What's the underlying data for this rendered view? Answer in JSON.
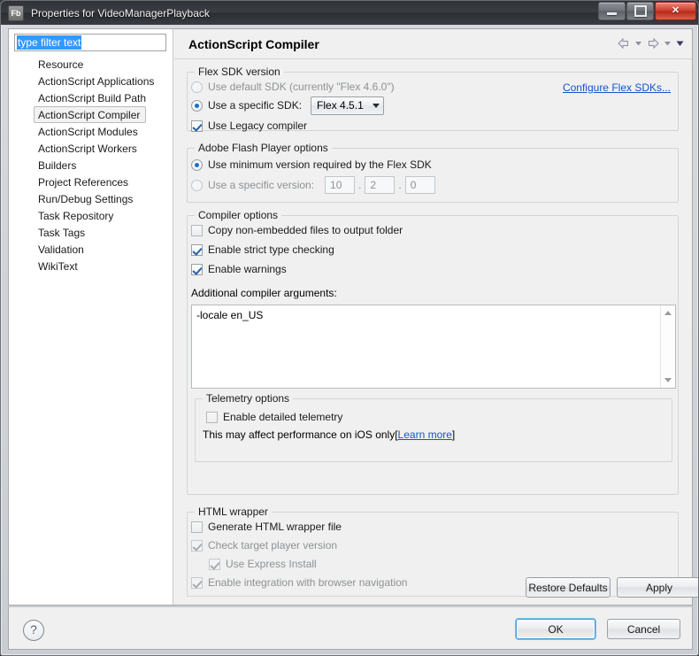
{
  "window": {
    "icon_label": "Fb",
    "title": "Properties for VideoManagerPlayback",
    "minimize_title": "Minimize",
    "maximize_title": "Maximize",
    "close_title": "Close"
  },
  "sidebar": {
    "filter": {
      "value": "type filter text",
      "placeholder": "type filter text"
    },
    "items": [
      {
        "label": "Resource",
        "selected": false
      },
      {
        "label": "ActionScript Applications",
        "selected": false
      },
      {
        "label": "ActionScript Build Path",
        "selected": false
      },
      {
        "label": "ActionScript Compiler",
        "selected": true
      },
      {
        "label": "ActionScript Modules",
        "selected": false
      },
      {
        "label": "ActionScript Workers",
        "selected": false
      },
      {
        "label": "Builders",
        "selected": false
      },
      {
        "label": "Project References",
        "selected": false
      },
      {
        "label": "Run/Debug Settings",
        "selected": false
      },
      {
        "label": "Task Repository",
        "selected": false
      },
      {
        "label": "Task Tags",
        "selected": false
      },
      {
        "label": "Validation",
        "selected": false
      },
      {
        "label": "WikiText",
        "selected": false
      }
    ]
  },
  "page": {
    "title": "ActionScript Compiler"
  },
  "sdk_group": {
    "legend": "Flex SDK version",
    "default_sdk_label": "Use default SDK (currently \"Flex 4.6.0\")",
    "specific_sdk_label": "Use a specific SDK:",
    "sdk_combo_value": "Flex 4.5.1",
    "legacy_compiler_label": "Use Legacy compiler",
    "configure_link": "Configure Flex SDKs..."
  },
  "flash_player_group": {
    "legend": "Adobe Flash Player options",
    "minimum_version_label": "Use minimum version required by the Flex SDK",
    "specific_version_label": "Use a specific version:",
    "version_major": "10",
    "version_minor": "2",
    "version_revision": "0",
    "separator": "."
  },
  "compiler_group": {
    "legend": "Compiler options",
    "copy_non_embedded_label": "Copy non-embedded files to output folder",
    "strict_type_label": "Enable strict type checking",
    "warnings_label": "Enable warnings",
    "additional_args_label": "Additional compiler arguments:",
    "additional_args_value": "-locale en_US"
  },
  "telemetry_group": {
    "legend": "Telemetry options",
    "enable_label": "Enable detailed telemetry",
    "note_prefix": "This may affect performance on iOS only[",
    "note_link": "Learn more",
    "note_suffix": "]"
  },
  "html_wrapper_group": {
    "legend": "HTML wrapper",
    "generate_label": "Generate HTML wrapper file",
    "check_target_label": "Check target player version",
    "express_install_label": "Use Express Install",
    "browser_navigation_label": "Enable integration with browser navigation"
  },
  "page_buttons": {
    "restore_defaults": "Restore Defaults",
    "apply": "Apply"
  },
  "dialog_buttons": {
    "help": "?",
    "ok": "OK",
    "cancel": "Cancel"
  },
  "colors": {
    "accent_blue": "#1c6fc4",
    "link_blue": "#1155cc",
    "selection_blue": "#3399ff",
    "panel_bg": "#f0f0f0",
    "tree_bg": "#ffffff",
    "close_red": "#cf3c29"
  }
}
